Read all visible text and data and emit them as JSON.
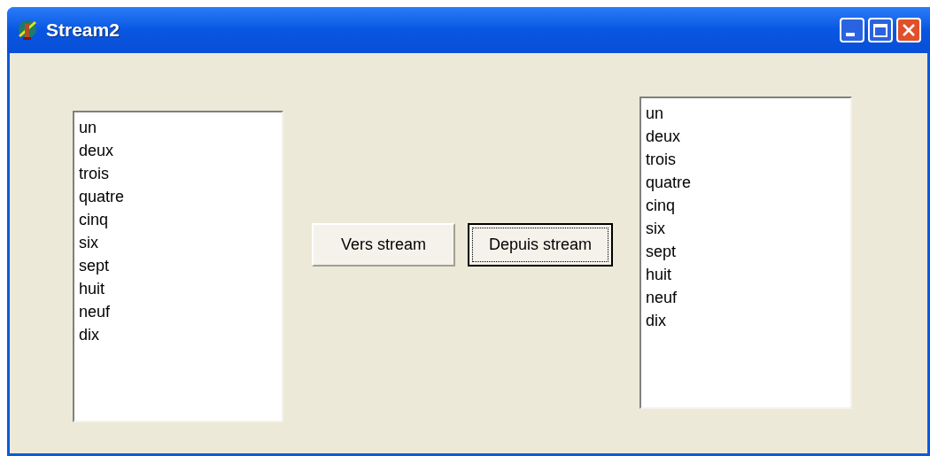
{
  "window": {
    "title": "Stream2"
  },
  "left_list": {
    "items": [
      "un",
      "deux",
      "trois",
      "quatre",
      "cinq",
      "six",
      "sept",
      "huit",
      "neuf",
      "dix"
    ]
  },
  "buttons": [
    {
      "label": "Vers stream",
      "focused": false
    },
    {
      "label": "Depuis stream",
      "focused": true
    }
  ],
  "right_list": {
    "items": [
      "un",
      "deux",
      "trois",
      "quatre",
      "cinq",
      "six",
      "sept",
      "huit",
      "neuf",
      "dix"
    ]
  }
}
